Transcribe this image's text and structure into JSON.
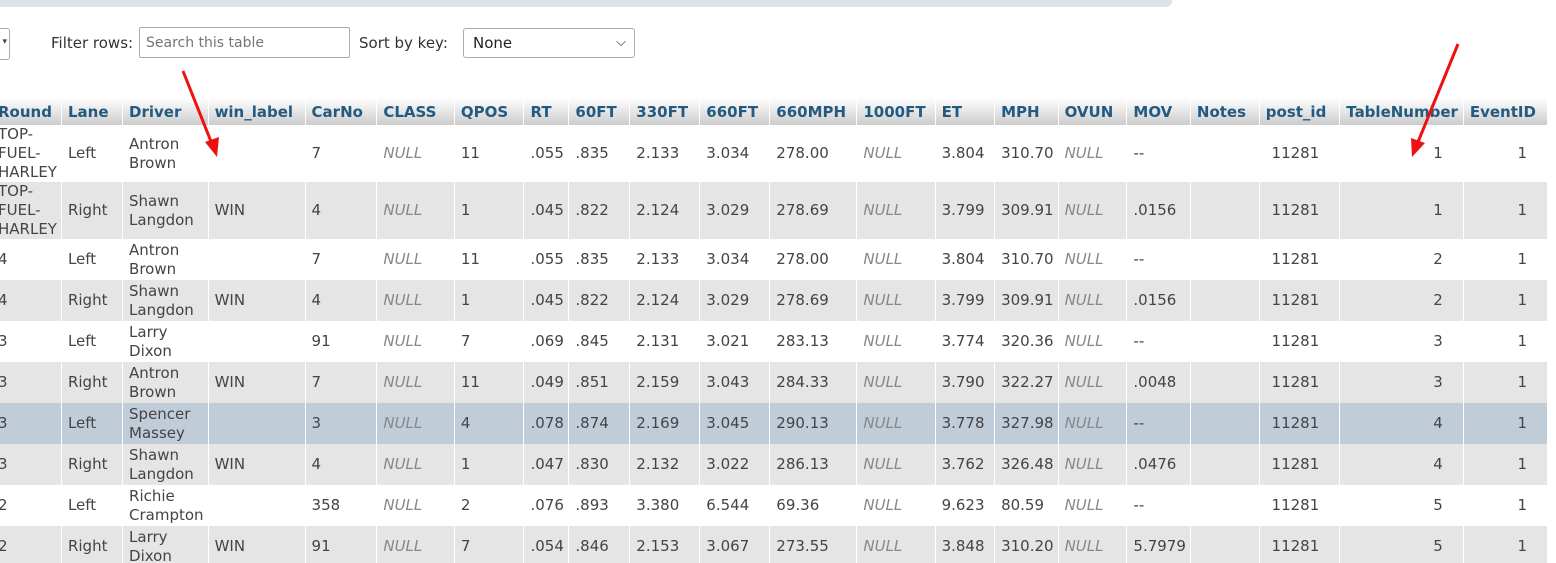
{
  "filter": {
    "label": "Filter rows:",
    "placeholder": "Search this table",
    "value": ""
  },
  "sort": {
    "label": "Sort by key:",
    "selected": "None"
  },
  "columns": [
    "Round",
    "Lane",
    "Driver",
    "win_label",
    "CarNo",
    "CLASS",
    "QPOS",
    "RT",
    "60FT",
    "330FT",
    "660FT",
    "660MPH",
    "1000FT",
    "ET",
    "MPH",
    "OVUN",
    "MOV",
    "Notes",
    "post_id",
    "TableNumber",
    "EventID"
  ],
  "rows": [
    [
      "TOP-\nFUEL-\nHARLEY",
      "Left",
      "Antron\nBrown",
      "",
      "7",
      "NULL",
      "11",
      ".055",
      ".835",
      "2.133",
      "3.034",
      "278.00",
      "NULL",
      "3.804",
      "310.70",
      "NULL",
      "--",
      "",
      "11281",
      "1",
      "1"
    ],
    [
      "TOP-\nFUEL-\nHARLEY",
      "Right",
      "Shawn\nLangdon",
      "WIN",
      "4",
      "NULL",
      "1",
      ".045",
      ".822",
      "2.124",
      "3.029",
      "278.69",
      "NULL",
      "3.799",
      "309.91",
      "NULL",
      ".0156",
      "",
      "11281",
      "1",
      "1"
    ],
    [
      "4",
      "Left",
      "Antron\nBrown",
      "",
      "7",
      "NULL",
      "11",
      ".055",
      ".835",
      "2.133",
      "3.034",
      "278.00",
      "NULL",
      "3.804",
      "310.70",
      "NULL",
      "--",
      "",
      "11281",
      "2",
      "1"
    ],
    [
      "4",
      "Right",
      "Shawn\nLangdon",
      "WIN",
      "4",
      "NULL",
      "1",
      ".045",
      ".822",
      "2.124",
      "3.029",
      "278.69",
      "NULL",
      "3.799",
      "309.91",
      "NULL",
      ".0156",
      "",
      "11281",
      "2",
      "1"
    ],
    [
      "3",
      "Left",
      "Larry\nDixon",
      "",
      "91",
      "NULL",
      "7",
      ".069",
      ".845",
      "2.131",
      "3.021",
      "283.13",
      "NULL",
      "3.774",
      "320.36",
      "NULL",
      "--",
      "",
      "11281",
      "3",
      "1"
    ],
    [
      "3",
      "Right",
      "Antron\nBrown",
      "WIN",
      "7",
      "NULL",
      "11",
      ".049",
      ".851",
      "2.159",
      "3.043",
      "284.33",
      "NULL",
      "3.790",
      "322.27",
      "NULL",
      ".0048",
      "",
      "11281",
      "3",
      "1"
    ],
    [
      "3",
      "Left",
      "Spencer\nMassey",
      "",
      "3",
      "NULL",
      "4",
      ".078",
      ".874",
      "2.169",
      "3.045",
      "290.13",
      "NULL",
      "3.778",
      "327.98",
      "NULL",
      "--",
      "",
      "11281",
      "4",
      "1"
    ],
    [
      "3",
      "Right",
      "Shawn\nLangdon",
      "WIN",
      "4",
      "NULL",
      "1",
      ".047",
      ".830",
      "2.132",
      "3.022",
      "286.13",
      "NULL",
      "3.762",
      "326.48",
      "NULL",
      ".0476",
      "",
      "11281",
      "4",
      "1"
    ],
    [
      "2",
      "Left",
      "Richie\nCrampton",
      "",
      "358",
      "NULL",
      "2",
      ".076",
      ".893",
      "3.380",
      "6.544",
      "69.36",
      "NULL",
      "9.623",
      "80.59",
      "NULL",
      "--",
      "",
      "11281",
      "5",
      "1"
    ],
    [
      "2",
      "Right",
      "Larry\nDixon",
      "WIN",
      "91",
      "NULL",
      "7",
      ".054",
      ".846",
      "2.153",
      "3.067",
      "273.55",
      "NULL",
      "3.848",
      "310.20",
      "NULL",
      "5.7979",
      "",
      "11281",
      "5",
      "1"
    ]
  ],
  "highlight_row": 6,
  "colors": {
    "header_text": "#235a81",
    "row_alt": "#e5e5e5",
    "row_hover": "#c1ccd9",
    "arrow": "#ee1111"
  }
}
